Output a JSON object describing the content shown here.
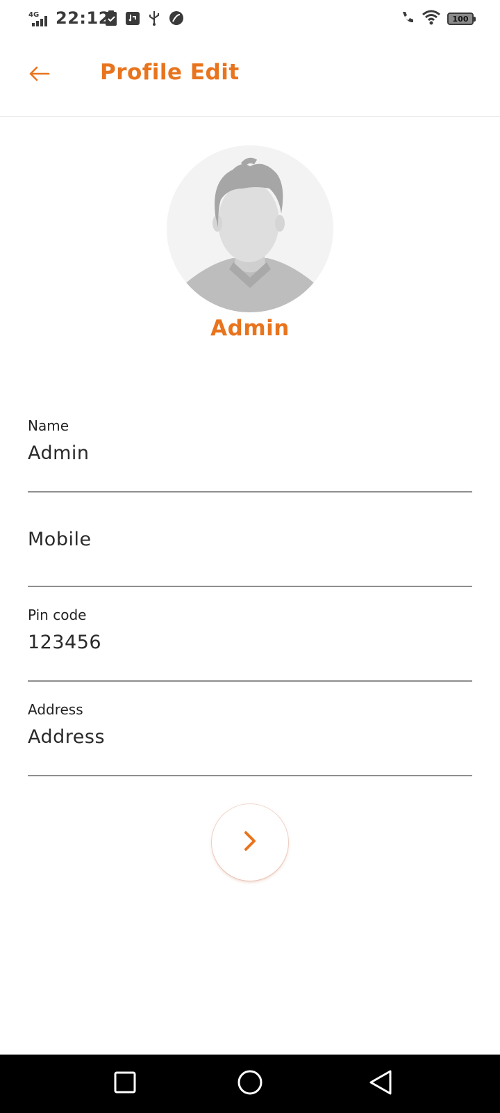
{
  "status_bar": {
    "network": "4G",
    "time": "22:12",
    "battery": "100"
  },
  "app_bar": {
    "title": "Profile Edit"
  },
  "profile": {
    "display_name": "Admin"
  },
  "form": {
    "name": {
      "label": "Name",
      "value": "Admin"
    },
    "mobile": {
      "placeholder": "Mobile"
    },
    "pincode": {
      "label": "Pin code",
      "value": "123456"
    },
    "address": {
      "label": "Address",
      "placeholder": "Address"
    }
  },
  "colors": {
    "accent": "#e8741e",
    "divider": "#8e8e8e"
  },
  "icons": {
    "back": "arrow-left-icon",
    "next": "chevron-right-icon",
    "nav_recents": "square-icon",
    "nav_home": "circle-icon",
    "nav_back": "triangle-back-icon"
  }
}
